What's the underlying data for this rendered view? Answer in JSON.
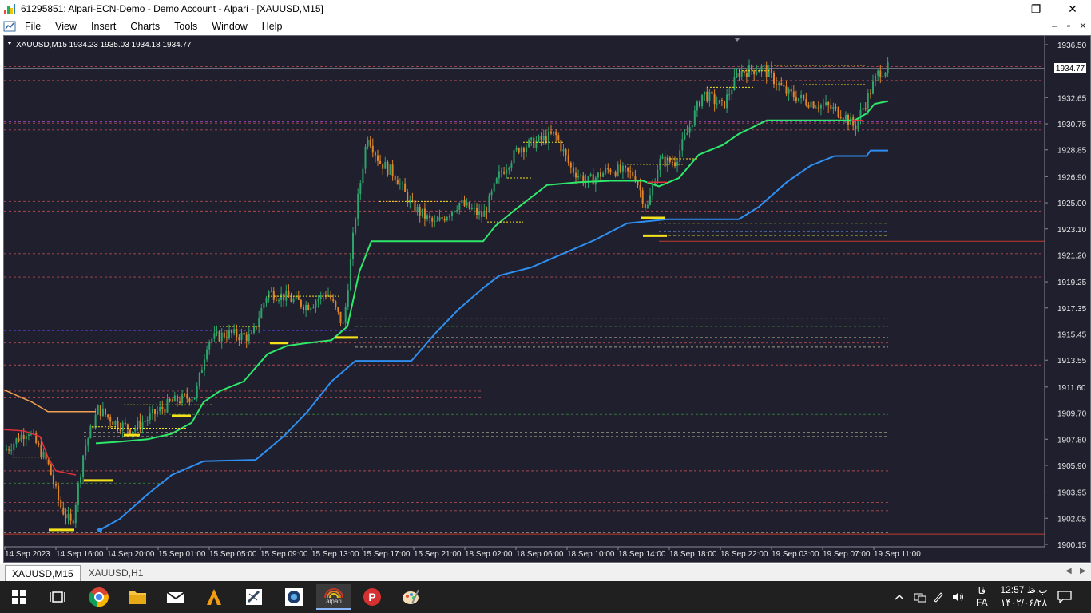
{
  "window": {
    "title": "61295851: Alpari-ECN-Demo - Demo Account - Alpari - [XAUUSD,M15]",
    "minimize": "—",
    "maximize": "❐",
    "close": "✕"
  },
  "menu": {
    "items": [
      "File",
      "View",
      "Insert",
      "Charts",
      "Tools",
      "Window",
      "Help"
    ],
    "mdi_minimize": "–",
    "mdi_restore": "▫",
    "mdi_close": "✕"
  },
  "chart": {
    "header": "XAUUSD,M15  1934.23 1935.03 1934.18 1934.77",
    "current_price": "1934.77",
    "price_labels": [
      "1936.50",
      "1932.65",
      "1930.75",
      "1928.85",
      "1926.90",
      "1925.00",
      "1923.10",
      "1921.20",
      "1919.25",
      "1917.35",
      "1915.45",
      "1913.55",
      "1911.60",
      "1909.70",
      "1907.80",
      "1905.90",
      "1903.95",
      "1902.05",
      "1900.15"
    ],
    "time_labels": [
      "14 Sep 2023",
      "14 Sep 16:00",
      "14 Sep 20:00",
      "15 Sep 01:00",
      "15 Sep 05:00",
      "15 Sep 09:00",
      "15 Sep 13:00",
      "15 Sep 17:00",
      "15 Sep 21:00",
      "18 Sep 02:00",
      "18 Sep 06:00",
      "18 Sep 10:00",
      "18 Sep 14:00",
      "18 Sep 18:00",
      "18 Sep 22:00",
      "19 Sep 03:00",
      "19 Sep 07:00",
      "19 Sep 11:00"
    ],
    "colors": {
      "background": "#1f1f2e",
      "bull": "#2ea36b",
      "bear": "#e0862a",
      "green_line": "#2ee86a",
      "blue_line": "#2f8ff0",
      "yellow": "#f5e11a",
      "red_level": "#c0392b"
    }
  },
  "tabs": [
    "XAUUSD,M15",
    "XAUUSD,H1"
  ],
  "taskbar": {
    "icons": [
      "windows-start-icon",
      "task-view-icon",
      "chrome-icon",
      "file-explorer-icon",
      "mail-icon",
      "a-app-icon",
      "pen-app-icon",
      "camera-app-icon",
      "alpari-icon",
      "p-app-icon",
      "paint-icon"
    ],
    "alpari_label": "alpari",
    "lang": "FA",
    "lang_top": "فا",
    "time": "12:57 ب.ظ",
    "date": "۱۴۰۲/۰۶/۲۸"
  }
}
